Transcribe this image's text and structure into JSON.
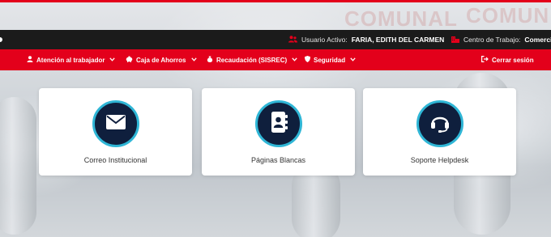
{
  "status_bar": {
    "user_label": "Usuario Activo:",
    "user_value": "FARIA, EDITH DEL CARMEN",
    "center_label": "Centro de Trabajo:",
    "center_value": "Comercializ",
    "user_icon": "users-icon",
    "center_icon": "building-icon"
  },
  "nav": {
    "items": [
      {
        "label": "Atención al trabajador",
        "icon": "user-icon"
      },
      {
        "label": "Caja de Ahorros",
        "icon": "piggy-bank-icon"
      },
      {
        "label": "Recaudación (SISREC)",
        "icon": "money-bag-icon"
      },
      {
        "label": "Seguridad",
        "icon": "shield-icon"
      }
    ],
    "logout_label": "Cerrar sesión",
    "logout_icon": "sign-out-icon"
  },
  "cards": [
    {
      "label": "Correo Institucional",
      "icon": "envelope-icon"
    },
    {
      "label": "Páginas Blancas",
      "icon": "address-book-icon"
    },
    {
      "label": "Soporte Helpdesk",
      "icon": "headset-icon"
    }
  ],
  "colors": {
    "brand_red": "#e3001b",
    "status_bar": "#1b1b1b",
    "icon_circle": "#0f1f3d",
    "icon_ring": "#2fb6d6"
  }
}
